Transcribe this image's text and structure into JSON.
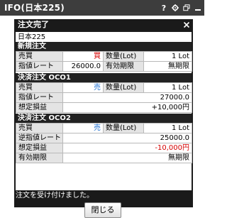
{
  "window": {
    "title": "IFO(日本225)",
    "help_glyph": "?"
  },
  "dialog": {
    "title": "注文完了",
    "close_glyph": "×",
    "symbol": "日本225",
    "new_order": {
      "heading": "新規注文",
      "side_label": "売買",
      "side_value": "買",
      "qty_label": "数量(Lot)",
      "qty_value": "1 Lot",
      "price_label": "指値レート",
      "price_value": "26000.0",
      "expiry_label": "有効期限",
      "expiry_value": "無期限"
    },
    "oco1": {
      "heading": "決済注文 OCO1",
      "side_label": "売買",
      "side_value": "売",
      "qty_label": "数量(Lot)",
      "qty_value": "1 Lot",
      "price_label": "指値レート",
      "price_value": "27000.0",
      "pl_label": "想定損益",
      "pl_value": "+10,000円"
    },
    "oco2": {
      "heading": "決済注文 OCO2",
      "side_label": "売買",
      "side_value": "売",
      "qty_label": "数量(Lot)",
      "qty_value": "1 Lot",
      "price_label": "逆指値レート",
      "price_value": "25000.0",
      "pl_label": "想定損益",
      "pl_value": "-10,000円",
      "expiry_label": "有効期限",
      "expiry_value": "無期限"
    },
    "message": "注文を受け付けました。",
    "close_button": "閉じる"
  },
  "colors": {
    "buy": "#d40000",
    "sell": "#1e6fd0",
    "negative": "#d40000"
  }
}
